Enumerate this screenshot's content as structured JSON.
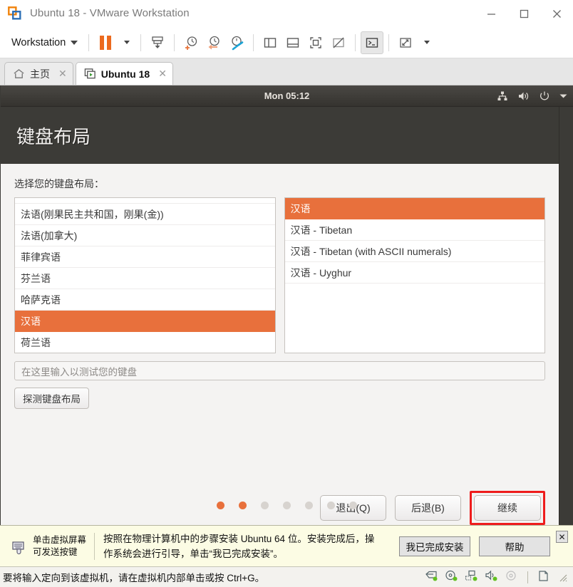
{
  "window": {
    "title": "Ubuntu 18 - VMware Workstation",
    "logo_icon": "vmware-logo-icon",
    "minimize_label": "—",
    "maximize_label": "□",
    "close_label": "✕"
  },
  "toolbar": {
    "menu_label": "Workstation",
    "buttons": [
      {
        "name": "pause-vm-button",
        "icon": "pause-icon"
      },
      {
        "name": "pause-dropdown-button",
        "icon": "chevron-down-icon"
      },
      {
        "name": "send-ctrl-alt-del-button",
        "icon": "keyboard-send-icon"
      },
      {
        "name": "take-snapshot-button",
        "icon": "snapshot-add-icon"
      },
      {
        "name": "revert-snapshot-button",
        "icon": "snapshot-revert-icon"
      },
      {
        "name": "snapshot-manager-button",
        "icon": "snapshot-manager-icon"
      },
      {
        "name": "show-left-pane-button",
        "icon": "panel-left-icon"
      },
      {
        "name": "show-bottom-pane-button",
        "icon": "panel-bottom-icon"
      },
      {
        "name": "full-screen-button",
        "icon": "fullscreen-icon"
      },
      {
        "name": "unity-mode-button",
        "icon": "unity-mode-icon"
      },
      {
        "name": "console-view-button",
        "icon": "console-icon"
      },
      {
        "name": "stretch-guest-button",
        "icon": "expand-arrows-icon"
      },
      {
        "name": "stretch-dropdown-button",
        "icon": "chevron-down-icon"
      }
    ]
  },
  "tabs": [
    {
      "label": "主页",
      "icon": "home-icon",
      "active": false,
      "close_label": "✕"
    },
    {
      "label": "Ubuntu 18",
      "icon": "vm-running-icon",
      "active": true,
      "close_label": "✕"
    }
  ],
  "guest": {
    "topbar": {
      "clock": "Mon 05:12",
      "indicators": [
        "network-icon",
        "volume-icon",
        "power-icon",
        "chevron-down-icon"
      ]
    },
    "installer": {
      "title": "键盘布局",
      "field_label": "选择您的键盘布局：",
      "layout_list": [
        {
          "label": "法语(刚果民主共和国，刚果(金))",
          "selected": false
        },
        {
          "label": "法语(加拿大)",
          "selected": false
        },
        {
          "label": "菲律宾语",
          "selected": false
        },
        {
          "label": "芬兰语",
          "selected": false
        },
        {
          "label": "哈萨克语",
          "selected": false
        },
        {
          "label": "汉语",
          "selected": true
        },
        {
          "label": "荷兰语",
          "selected": false
        }
      ],
      "variant_list": [
        {
          "label": "汉语",
          "selected": true
        },
        {
          "label": "汉语 - Tibetan",
          "selected": false
        },
        {
          "label": "汉语 - Tibetan (with ASCII numerals)",
          "selected": false
        },
        {
          "label": "汉语 - Uyghur",
          "selected": false
        }
      ],
      "test_input_placeholder": "在这里输入以测试您的键盘",
      "test_input_value": "",
      "detect_button": "探测键盘布局",
      "nav": {
        "quit": "退出(Q)",
        "back": "后退(B)",
        "continue": "继续"
      },
      "progress_dots": [
        true,
        true,
        false,
        false,
        false,
        false,
        false
      ],
      "highlight_color": "#ee1c1c",
      "accent_color": "#e8703c"
    }
  },
  "notification": {
    "keyboard_icon": "keyboard-icon",
    "hint_line1": "单击虚拟屏幕",
    "hint_line2": "可发送按键",
    "message": "按照在物理计算机中的步骤安装 Ubuntu 64 位。安装完成后，操作系统会进行引导，单击“我已完成安装”。",
    "finished_button": "我已完成安装",
    "help_button": "帮助",
    "close_label": "✕"
  },
  "statusbar": {
    "message": "要将输入定向到该虚拟机，请在虚拟机内部单击或按 Ctrl+G。",
    "devices": [
      {
        "name": "status-hard-disk-icon",
        "icon": "hard-disk-icon"
      },
      {
        "name": "status-cd-dvd-icon",
        "icon": "cd-dvd-icon"
      },
      {
        "name": "status-network-icon",
        "icon": "network-icon"
      },
      {
        "name": "status-sound-icon",
        "icon": "sound-icon"
      },
      {
        "name": "status-floppy-icon",
        "icon": "floppy-disc-icon"
      },
      {
        "name": "status-usb-icon",
        "icon": "document-icon"
      }
    ]
  }
}
